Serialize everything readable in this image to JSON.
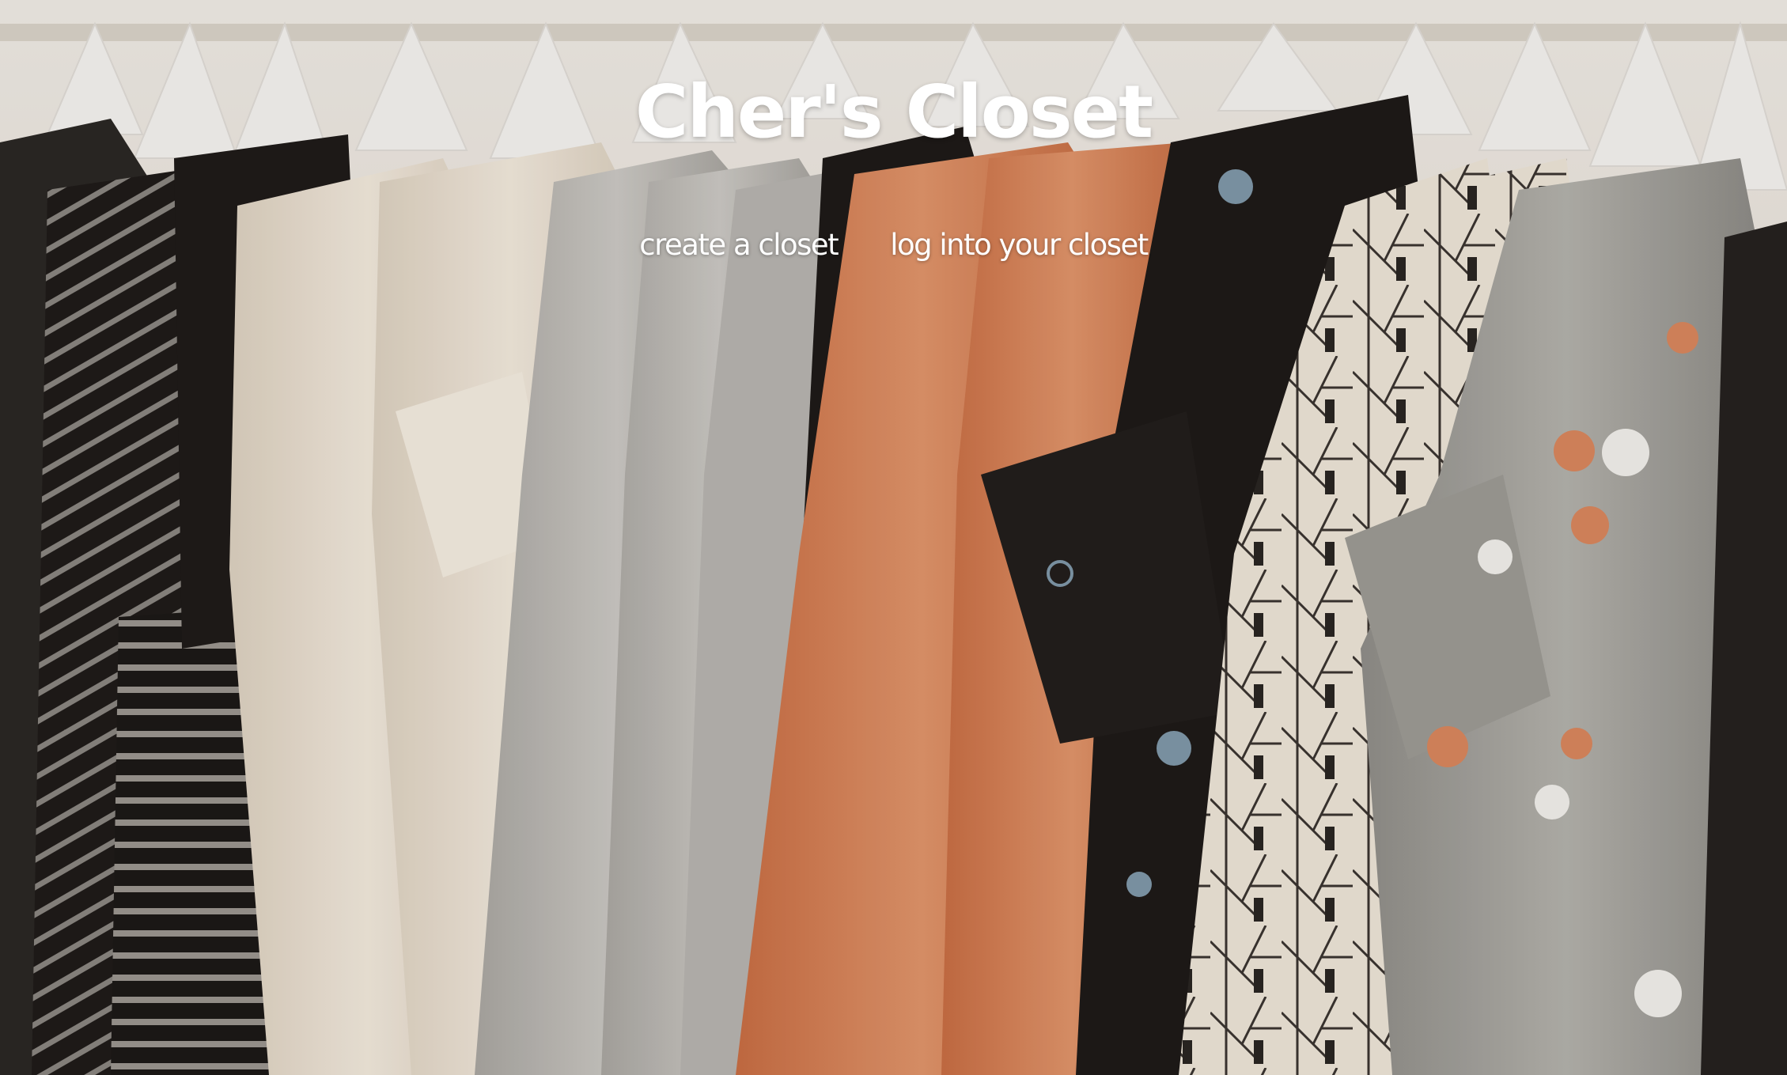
{
  "site": {
    "title": "Cher's Closet"
  },
  "nav": {
    "items": [
      {
        "label": "create a closet"
      },
      {
        "label": "log into your closet"
      }
    ]
  },
  "background": {
    "subject": "clothes-on-hangers-rack",
    "colors": {
      "wall": "#e9e3db",
      "hanger": "#f3f1ee",
      "cream": "#eadfce",
      "black": "#1f1b19",
      "grey_knit": "#b9b6b1",
      "rust": "#d27d52",
      "grey_shirt": "#a6a49e",
      "polka_dot_orange": "#d9865d",
      "polka_dot_blue": "#7f97a8"
    }
  }
}
